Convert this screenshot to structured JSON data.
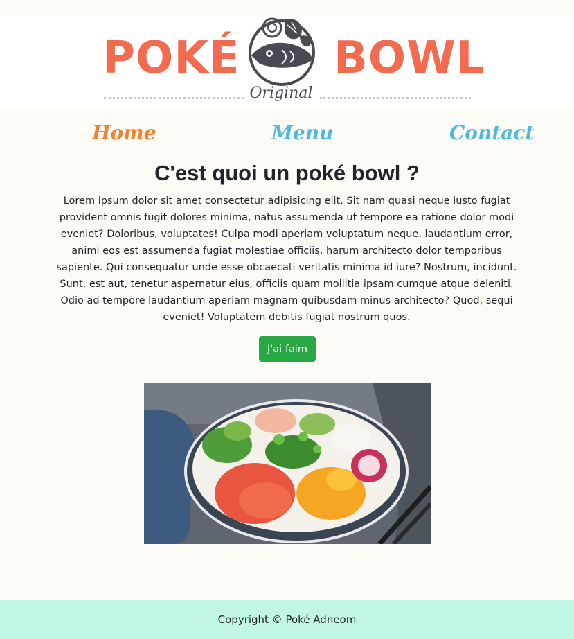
{
  "logo": {
    "word_left": "POKÉ",
    "word_right": "BOWL",
    "subtitle": "Original",
    "brand_color": "#f26b4f",
    "icon": "fish-bowl-icon"
  },
  "nav": {
    "items": [
      {
        "label": "Home",
        "color": "#f2812b"
      },
      {
        "label": "Menu",
        "color": "#4fb8dd"
      },
      {
        "label": "Contact",
        "color": "#4fb8dd"
      }
    ]
  },
  "main": {
    "title": "C'est quoi un poké bowl ?",
    "paragraph": "Lorem ipsum dolor sit amet consectetur adipisicing elit. Sit nam quasi neque iusto fugiat provident omnis fugit dolores minima, natus assumenda ut tempore ea ratione dolor modi eveniet? Doloribus, voluptates! Culpa modi aperiam voluptatum neque, laudantium error, animi eos est assumenda fugiat molestiae officiis, harum architecto dolor temporibus sapiente. Qui consequatur unde esse obcaecati veritatis minima id iure? Nostrum, incidunt. Sunt, est aut, tenetur aspernatur eius, officiis quam mollitia ipsam cumque atque deleniti. Odio ad tempore laudantium aperiam magnam quibusdam minus architecto? Quod, sequi eveniet! Voluptatem debitis fugiat nostrum quos.",
    "button_label": "J'ai faim",
    "button_color": "#28a745"
  },
  "footer": {
    "text": "Copyright © Poké Adneom",
    "background": "#c1f5e5"
  }
}
